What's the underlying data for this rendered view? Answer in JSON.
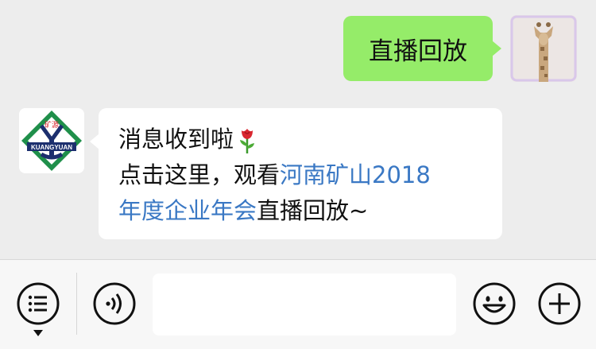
{
  "messages": {
    "outgoing": {
      "text": "直播回放"
    },
    "incoming": {
      "line1": "消息收到啦",
      "line2_prefix": "点击这里，观看",
      "link_part1": "河南矿山2018",
      "link_part2": "年度企业年会",
      "line3_suffix": "直播回放~"
    }
  },
  "org_avatar": {
    "logo_text_top": "矿源",
    "logo_text_band": "KUANGYUAN"
  },
  "input_bar": {
    "input_placeholder": "",
    "icons": [
      "menu-list-icon",
      "voice-icon",
      "emoji-icon",
      "plus-icon"
    ]
  },
  "colors": {
    "background": "#ededed",
    "outgoing_bubble": "#95ec69",
    "incoming_bubble": "#ffffff",
    "link": "#3a78c4",
    "logo_green": "#1f8f4a",
    "logo_red": "#d8262e",
    "logo_navy": "#1c2f6e"
  }
}
